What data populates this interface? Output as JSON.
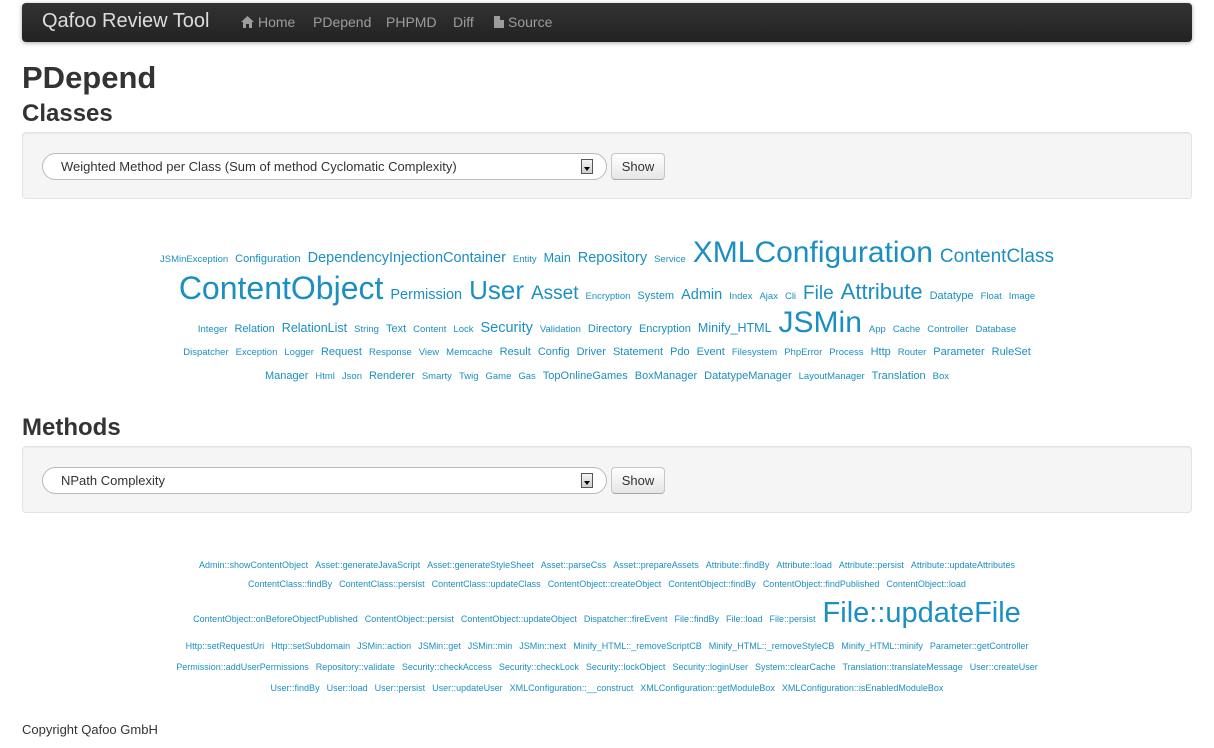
{
  "navbar": {
    "brand": "Qafoo Review Tool",
    "items": [
      {
        "label": "Home",
        "icon": "home-icon"
      },
      {
        "label": "PDepend"
      },
      {
        "label": "PHPMD"
      },
      {
        "label": "Diff"
      },
      {
        "label": "Source",
        "icon": "file-icon"
      }
    ]
  },
  "page_title": "PDepend",
  "classes": {
    "heading": "Classes",
    "select_value": "Weighted Method per Class (Sum of method Cyclomatic Complexity)",
    "show_label": "Show"
  },
  "methods": {
    "heading": "Methods",
    "select_value": "NPath Complexity",
    "show_label": "Show"
  },
  "class_cloud": [
    [
      [
        "JSMinException",
        1
      ],
      [
        "Configuration",
        2
      ],
      [
        "DependencyInjectionContainer",
        4
      ],
      [
        "Entity",
        1
      ],
      [
        "Main",
        3
      ],
      [
        "Repository",
        4
      ],
      [
        "Service",
        1
      ],
      [
        "XMLConfiguration",
        8
      ],
      [
        "ContentClass",
        5
      ]
    ],
    [
      [
        "ContentObject",
        9
      ],
      [
        "Permission",
        4
      ],
      [
        "User",
        7
      ],
      [
        "Asset",
        5
      ],
      [
        "Encryption",
        1
      ],
      [
        "System",
        2
      ],
      [
        "Admin",
        4
      ],
      [
        "Index",
        1
      ],
      [
        "Ajax",
        1
      ],
      [
        "Cli",
        1
      ],
      [
        "File",
        5
      ],
      [
        "Attribute",
        6
      ],
      [
        "Datatype",
        2
      ],
      [
        "Float",
        1
      ],
      [
        "Image",
        1
      ]
    ],
    [
      [
        "Integer",
        1
      ],
      [
        "Relation",
        2
      ],
      [
        "RelationList",
        3
      ],
      [
        "String",
        1
      ],
      [
        "Text",
        2
      ],
      [
        "Content",
        1
      ],
      [
        "Lock",
        1
      ],
      [
        "Security",
        4
      ],
      [
        "Validation",
        1
      ],
      [
        "Directory",
        2
      ],
      [
        "Encryption",
        2
      ],
      [
        "Minify_HTML",
        3
      ],
      [
        "JSMin",
        8
      ],
      [
        "App",
        1
      ],
      [
        "Cache",
        1
      ],
      [
        "Controller",
        1
      ],
      [
        "Database",
        1
      ]
    ],
    [
      [
        "Dispatcher",
        1
      ],
      [
        "Exception",
        1
      ],
      [
        "Logger",
        1
      ],
      [
        "Request",
        2
      ],
      [
        "Response",
        1
      ],
      [
        "View",
        1
      ],
      [
        "Memcache",
        1
      ],
      [
        "Result",
        2
      ],
      [
        "Config",
        2
      ],
      [
        "Driver",
        2
      ],
      [
        "Statement",
        2
      ],
      [
        "Pdo",
        2
      ],
      [
        "Event",
        2
      ],
      [
        "Filesystem",
        1
      ],
      [
        "PhpError",
        1
      ],
      [
        "Process",
        1
      ],
      [
        "Http",
        2
      ],
      [
        "Router",
        1
      ],
      [
        "Parameter",
        2
      ],
      [
        "RuleSet",
        2
      ]
    ],
    [
      [
        "Manager",
        2
      ],
      [
        "Html",
        1
      ],
      [
        "Json",
        1
      ],
      [
        "Renderer",
        2
      ],
      [
        "Smarty",
        1
      ],
      [
        "Twig",
        1
      ],
      [
        "Game",
        1
      ],
      [
        "Gas",
        1
      ],
      [
        "TopOnlineGames",
        2
      ],
      [
        "BoxManager",
        2
      ],
      [
        "DatatypeManager",
        2
      ],
      [
        "LayoutManager",
        1
      ],
      [
        "Translation",
        2
      ],
      [
        "Box",
        1
      ]
    ]
  ],
  "method_cloud": [
    [
      [
        "Admin::showContentObject",
        1
      ],
      [
        "Asset::generateJavaScript",
        1
      ],
      [
        "Asset::generateStyleSheet",
        1
      ],
      [
        "Asset::parseCss",
        1
      ],
      [
        "Asset::prepareAssets",
        1
      ],
      [
        "Attribute::findBy",
        1
      ],
      [
        "Attribute::load",
        1
      ],
      [
        "Attribute::persist",
        1
      ],
      [
        "Attribute::updateAttributes",
        1
      ]
    ],
    [
      [
        "ContentClass::findBy",
        1
      ],
      [
        "ContentClass::persist",
        1
      ],
      [
        "ContentClass::updateClass",
        1
      ],
      [
        "ContentObject::createObject",
        1
      ],
      [
        "ContentObject::findBy",
        1
      ],
      [
        "ContentObject::findPublished",
        1
      ],
      [
        "ContentObject::load",
        1
      ]
    ],
    [
      [
        "ContentObject::onBeforeObjectPublished",
        1
      ],
      [
        "ContentObject::persist",
        1
      ],
      [
        "ContentObject::updateObject",
        1
      ],
      [
        "Dispatcher::fireEvent",
        1
      ],
      [
        "File::findBy",
        1
      ],
      [
        "File::load",
        1
      ],
      [
        "File::persist",
        1
      ],
      [
        "File::updateFile",
        8
      ]
    ],
    [
      [
        "Http::setRequestUri",
        1
      ],
      [
        "Http::setSubdomain",
        1
      ],
      [
        "JSMin::action",
        1
      ],
      [
        "JSMin::get",
        1
      ],
      [
        "JSMin::min",
        1
      ],
      [
        "JSMin::next",
        1
      ],
      [
        "Minify_HTML::_removeScriptCB",
        1
      ],
      [
        "Minify_HTML::_removeStyleCB",
        1
      ],
      [
        "Minify_HTML::minify",
        1
      ],
      [
        "Parameter::getController",
        1
      ]
    ],
    [
      [
        "Permission::addUserPermissions",
        1
      ],
      [
        "Repository::validate",
        1
      ],
      [
        "Security::checkAccess",
        1
      ],
      [
        "Security::checkLock",
        1
      ],
      [
        "Security::lockObject",
        1
      ],
      [
        "Security::loginUser",
        1
      ],
      [
        "System::clearCache",
        1
      ],
      [
        "Translation::translateMessage",
        1
      ],
      [
        "User::createUser",
        1
      ]
    ],
    [
      [
        "User::findBy",
        1
      ],
      [
        "User::load",
        1
      ],
      [
        "User::persist",
        1
      ],
      [
        "User::updateUser",
        1
      ],
      [
        "XMLConfiguration::__construct",
        1
      ],
      [
        "XMLConfiguration::getModuleBox",
        1
      ],
      [
        "XMLConfiguration::isEnabledModuleBox",
        1
      ]
    ]
  ],
  "copyright": "Copyright Qafoo GmbH",
  "colors": {
    "link": "#1b8fc1",
    "navbar": "#222222",
    "well": "#f5f5f5"
  }
}
